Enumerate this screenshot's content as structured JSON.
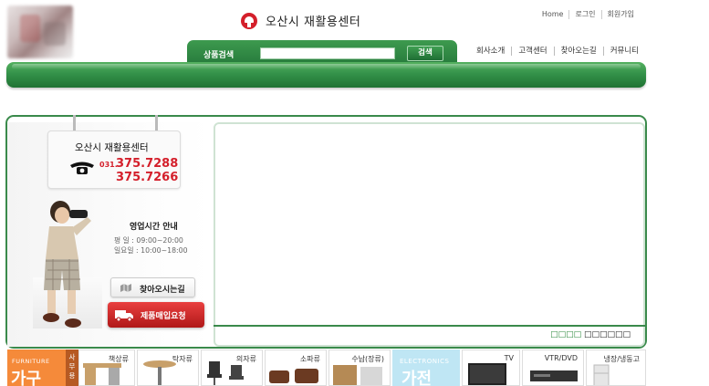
{
  "header": {
    "brand_name": "오산시 재활용센터",
    "utility_links": [
      "Home",
      "로그인",
      "회원가입"
    ],
    "search": {
      "label": "상품검색",
      "input_value": "",
      "button_label": "검색"
    },
    "gnb": [
      "회사소개",
      "고객센터",
      "찾아오는길",
      "커뮤니티"
    ]
  },
  "sidebar": {
    "sign_title": "오산시 재활용센터",
    "phone_prefix": "031.",
    "phone_numbers": [
      "375.7288",
      "375.7266"
    ],
    "hours_title": "영업시간 안내",
    "hours": [
      "평    일 : 09:00~20:00",
      "일요일 : 10:00~18:00"
    ],
    "directions_button": "찾아오시는길",
    "purchase_button": "제품매입요청"
  },
  "content": {
    "footer_highlight": "□□□□",
    "footer_text": "□□□□□□"
  },
  "categories": {
    "furniture_en": "FURNITURE",
    "furniture_ko": "가구",
    "sub_tab": "사무용",
    "electronics_en": "ELECTRONICS",
    "electronics_ko": "가전",
    "items": [
      "책상류",
      "탁자류",
      "의자류",
      "소파류",
      "수납(장류)",
      "TV",
      "VTR/DVD",
      "냉장/냉동고"
    ]
  },
  "colors": {
    "brand_green": "#2e8a3f",
    "accent_red": "#d41f2b",
    "furniture_orange": "#f58a3a",
    "electronics_blue": "#bfe6f4"
  }
}
